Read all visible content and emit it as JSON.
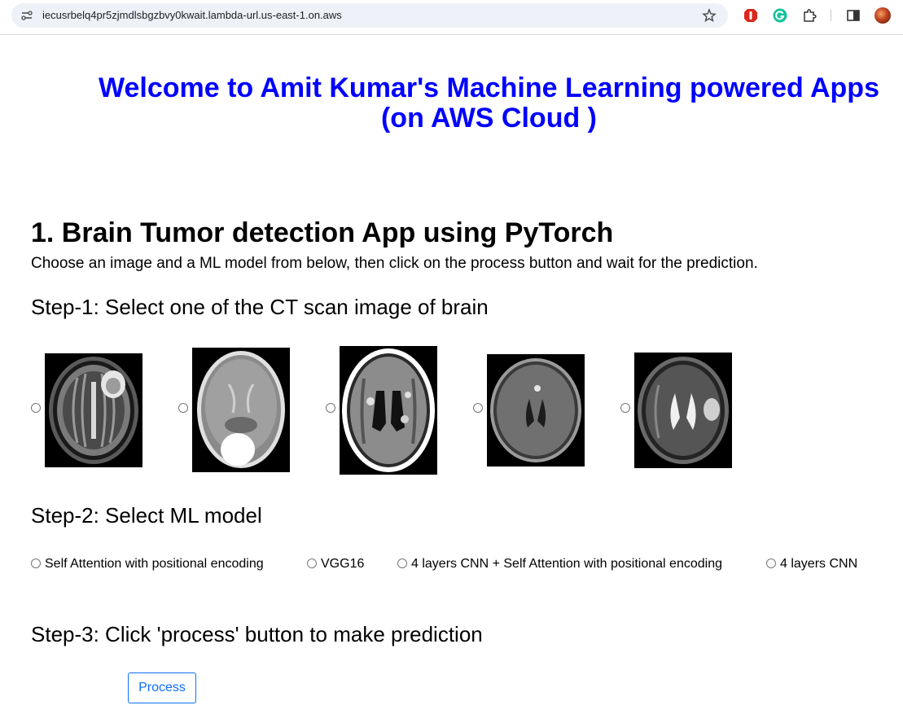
{
  "browser": {
    "url": "iecusrbelq4pr5zjmdlsbgzbvy0kwait.lambda-url.us-east-1.on.aws",
    "icons": [
      "site-info-icon",
      "star-icon",
      "adblock-icon",
      "grammarly-icon",
      "extensions-puzzle-icon",
      "side-panel-icon",
      "profile-avatar"
    ]
  },
  "page": {
    "title_line1": "Welcome to Amit Kumar's Machine Learning powered Apps",
    "title_line2": "(on AWS Cloud )",
    "title_color": "#0000ff",
    "app_heading": "1. Brain Tumor detection App using PyTorch",
    "app_description": "Choose an image and a ML model from below, then click on the process button and wait for the prediction.",
    "step1": "Step-1: Select one of the CT scan image of brain",
    "step2": "Step-2: Select ML model",
    "step3": "Step-3: Click 'process' button to make prediction",
    "images": [
      "brain-scan-1",
      "brain-scan-2",
      "brain-scan-3",
      "brain-scan-4",
      "brain-scan-5"
    ],
    "models": [
      {
        "label": "Self Attention with positional encoding"
      },
      {
        "label": "VGG16"
      },
      {
        "label": "4 layers CNN + Self Attention with positional encoding"
      },
      {
        "label": "4 layers CNN"
      }
    ],
    "process_button": "Process",
    "accent_color": "#0d6efd"
  }
}
